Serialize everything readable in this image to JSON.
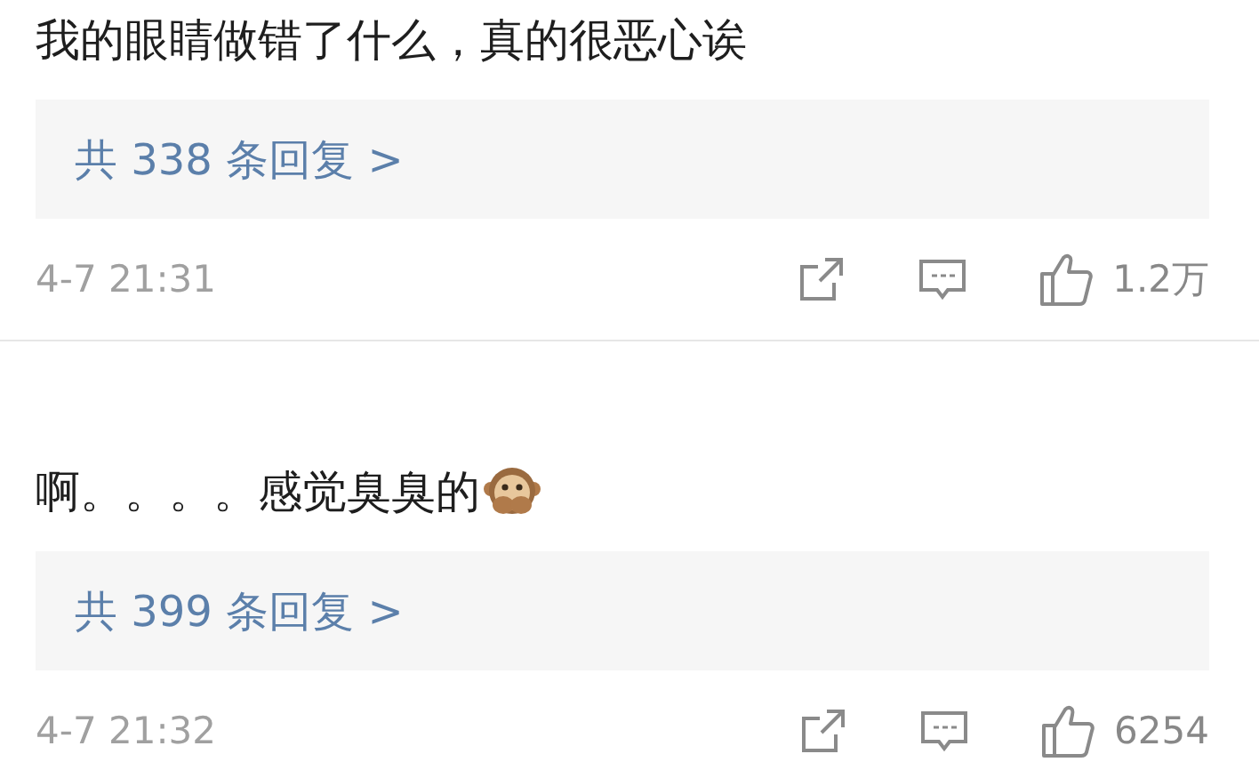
{
  "comments": [
    {
      "text": "我的眼睛做错了什么，真的很恶心诶",
      "emoji": false,
      "replies": "共 338 条回复 >",
      "time": "4-7 21:31",
      "likes": "1.2万"
    },
    {
      "text": "啊。。。。感觉臭臭的",
      "emoji": true,
      "replies": "共 399 条回复 >",
      "time": "4-7 21:32",
      "likes": "6254"
    }
  ]
}
